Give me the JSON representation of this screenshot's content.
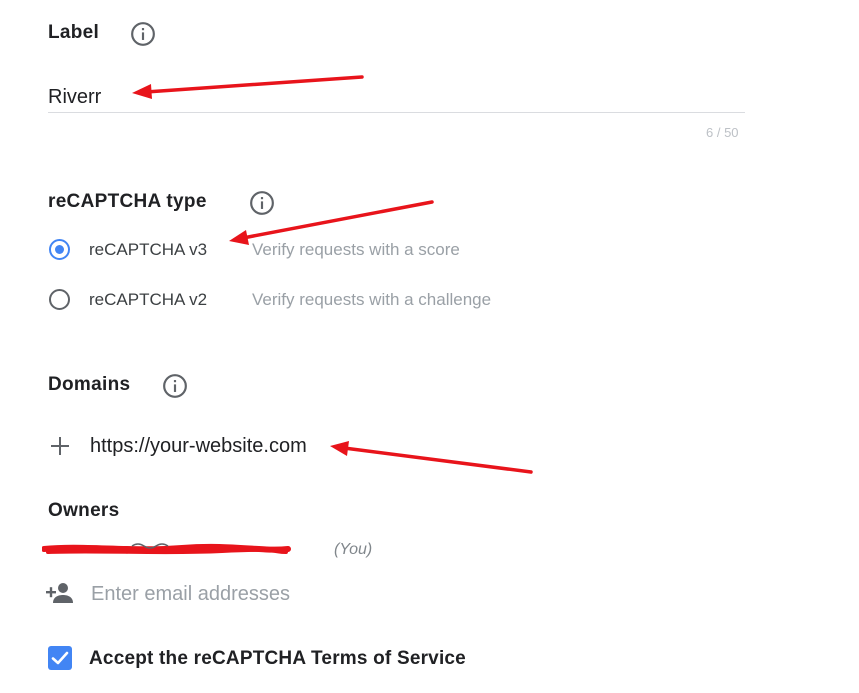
{
  "label_section": {
    "title": "Label",
    "value": "Riverr",
    "counter": "6 / 50",
    "info_icon": "info-icon"
  },
  "recaptcha_type": {
    "title": "reCAPTCHA type",
    "info_icon": "info-icon",
    "options": [
      {
        "label": "reCAPTCHA v3",
        "description": "Verify requests with a score",
        "selected": true
      },
      {
        "label": "reCAPTCHA v2",
        "description": "Verify requests with a challenge",
        "selected": false
      }
    ]
  },
  "domains": {
    "title": "Domains",
    "info_icon": "info-icon",
    "add_icon": "plus-icon",
    "value": "https://your-website.com"
  },
  "owners": {
    "title": "Owners",
    "current_owner_tag": "(You)",
    "add_user_icon": "person-add-icon",
    "email_placeholder": "Enter email addresses"
  },
  "terms": {
    "label": "Accept the reCAPTCHA Terms of Service",
    "checked": true
  },
  "colors": {
    "accent": "#4285f4",
    "annotation_arrow": "#e8141b",
    "redaction": "#e8141b"
  }
}
